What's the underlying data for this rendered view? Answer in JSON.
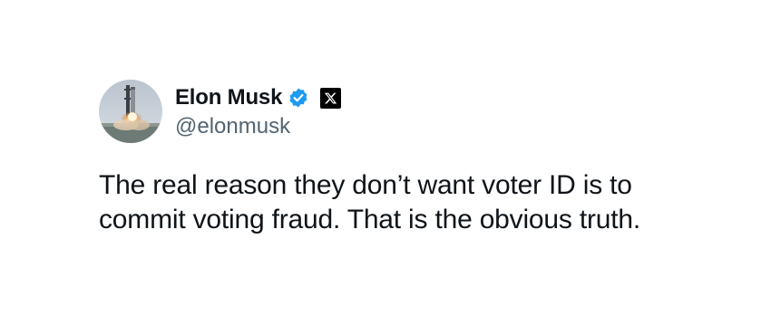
{
  "tweet": {
    "author": {
      "display_name": "Elon Musk",
      "handle": "@elonmusk",
      "verified_icon": "verified-badge-icon",
      "platform_icon": "x-logo-icon",
      "avatar": "rocket-launch-avatar"
    },
    "text": "The real reason they don’t want voter ID is to commit voting fraud. That is the obvious truth.",
    "platform_logo_glyph": "𝕏"
  },
  "colors": {
    "text": "#0f1419",
    "handle": "#536471",
    "verified": "#1d9bf0",
    "x_logo_bg": "#000000"
  }
}
